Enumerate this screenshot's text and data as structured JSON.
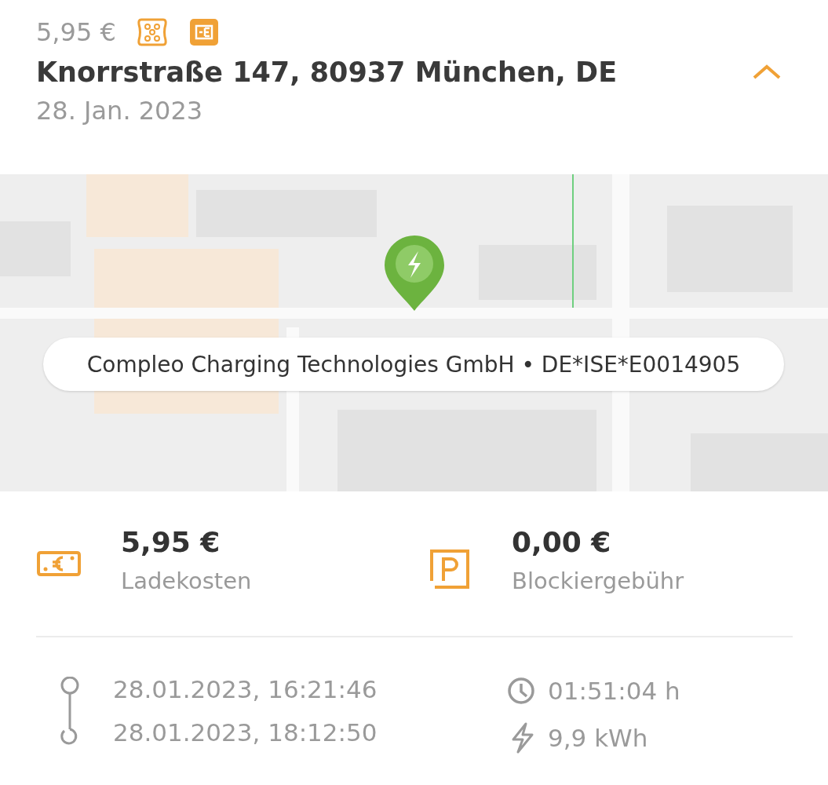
{
  "header": {
    "price": "5,95 €",
    "title": "Knorrstraße 147, 80937 München, DE",
    "date": "28. Jan. 2023",
    "expanded": true
  },
  "map": {
    "kind": "picture",
    "label": "Compleo Charging Technologies GmbH • DE*ISE*E0014905"
  },
  "costs": [
    {
      "kind": "charging",
      "amount": "5,95 €",
      "label": "Ladekosten"
    },
    {
      "kind": "parking",
      "amount": "0,00 €",
      "label": "Blockiergebühr"
    }
  ],
  "session": {
    "start": "28.01.2023, 16:21:46",
    "end": "28.01.2023, 18:12:50",
    "duration": "01:51:04 h",
    "energy": "9,9 kWh"
  }
}
